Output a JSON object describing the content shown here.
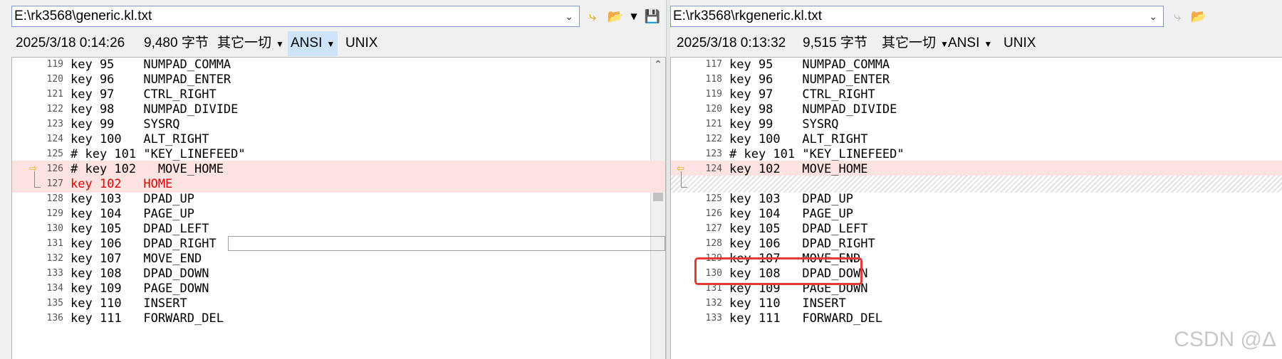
{
  "left": {
    "path": "E:\\rk3568\\generic.kl.txt",
    "info": {
      "date": "2025/3/18 0:14:26",
      "size": "9,480 字节",
      "filter": "其它一切",
      "encoding": "ANSI",
      "eol": "UNIX"
    },
    "lines": [
      {
        "n": "119",
        "t": "key 95    NUMPAD_COMMA"
      },
      {
        "n": "120",
        "t": "key 96    NUMPAD_ENTER"
      },
      {
        "n": "121",
        "t": "key 97    CTRL_RIGHT"
      },
      {
        "n": "122",
        "t": "key 98    NUMPAD_DIVIDE"
      },
      {
        "n": "123",
        "t": "key 99    SYSRQ"
      },
      {
        "n": "124",
        "t": "key 100   ALT_RIGHT"
      },
      {
        "n": "125",
        "t": "# key 101 \"KEY_LINEFEED\""
      },
      {
        "n": "126",
        "t": "# key 102   MOVE_HOME"
      },
      {
        "n": "127",
        "t": "key 102   HOME"
      },
      {
        "n": "128",
        "t": "key 103   DPAD_UP"
      },
      {
        "n": "129",
        "t": "key 104   PAGE_UP"
      },
      {
        "n": "130",
        "t": "key 105   DPAD_LEFT"
      },
      {
        "n": "131",
        "t": "key 106   DPAD_RIGHT"
      },
      {
        "n": "132",
        "t": "key 107   MOVE_END"
      },
      {
        "n": "133",
        "t": "key 108   DPAD_DOWN"
      },
      {
        "n": "134",
        "t": "key 109   PAGE_DOWN"
      },
      {
        "n": "135",
        "t": "key 110   INSERT"
      },
      {
        "n": "136",
        "t": "key 111   FORWARD_DEL"
      }
    ]
  },
  "right": {
    "path": "E:\\rk3568\\rkgeneric.kl.txt",
    "info": {
      "date": "2025/3/18 0:13:32",
      "size": "9,515 字节",
      "filter": "其它一切",
      "encoding": "ANSI",
      "eol": "UNIX"
    },
    "lines": [
      {
        "n": "117",
        "t": "key 95    NUMPAD_COMMA"
      },
      {
        "n": "118",
        "t": "key 96    NUMPAD_ENTER"
      },
      {
        "n": "119",
        "t": "key 97    CTRL_RIGHT"
      },
      {
        "n": "120",
        "t": "key 98    NUMPAD_DIVIDE"
      },
      {
        "n": "121",
        "t": "key 99    SYSRQ"
      },
      {
        "n": "122",
        "t": "key 100   ALT_RIGHT"
      },
      {
        "n": "123",
        "t": "# key 101 \"KEY_LINEFEED\""
      },
      {
        "n": "124",
        "t": "key 102   MOVE_HOME"
      },
      {
        "n": "",
        "t": ""
      },
      {
        "n": "125",
        "t": "key 103   DPAD_UP"
      },
      {
        "n": "126",
        "t": "key 104   PAGE_UP"
      },
      {
        "n": "127",
        "t": "key 105   DPAD_LEFT"
      },
      {
        "n": "128",
        "t": "key 106   DPAD_RIGHT"
      },
      {
        "n": "129",
        "t": "key 107   MOVE_END"
      },
      {
        "n": "130",
        "t": "key 108   DPAD_DOWN"
      },
      {
        "n": "131",
        "t": "key 109   PAGE_DOWN"
      },
      {
        "n": "132",
        "t": "key 110   INSERT"
      },
      {
        "n": "133",
        "t": "key 111   FORWARD_DEL"
      }
    ]
  },
  "watermark": "CSDN @Δ",
  "colors": {
    "diff_background": "#fde2e2",
    "changed_text": "#e00000",
    "highlight_box": "#e53935"
  }
}
